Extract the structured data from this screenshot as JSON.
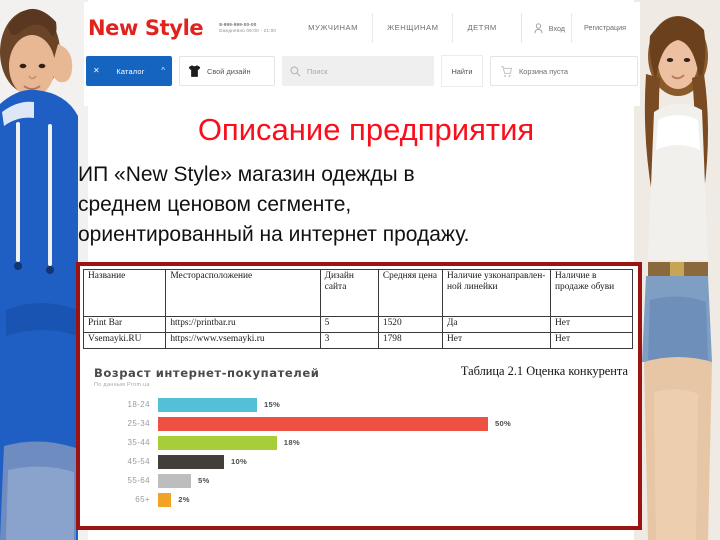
{
  "site": {
    "logo": "New Style",
    "phone": "8-999-999-00-00",
    "hours": "Ежедневно 09:00 - 21:00",
    "nav": [
      {
        "label": "МУЖЧИНАМ"
      },
      {
        "label": "ЖЕНЩИНАМ"
      },
      {
        "label": "ДЕТЯМ"
      }
    ],
    "login_label": "Вход",
    "register_label": "Регистрация",
    "catalog_label": "Каталог",
    "design_label": "Свой дизайн",
    "search_placeholder": "Поиск",
    "find_label": "Найти",
    "cart_label": "Корзина пуста",
    "icons": {
      "person": "person-icon",
      "tshirt": "tshirt-icon",
      "search": "search-icon",
      "cart": "cart-icon",
      "chevron": "chevron-up-icon",
      "close": "close-x-icon"
    },
    "accent_blue": "#1565c0",
    "logo_red": "#e0231d"
  },
  "slide": {
    "title": "Описание предприятия",
    "title_color": "#fc0d1b",
    "body_lines": [
      "ИП «New Style» магазин одежды в",
      "среднем ценовом сегменте,",
      "ориентированный на интернет продажу."
    ]
  },
  "table": {
    "caption": "Таблица 2.1 Оценка конкурента",
    "headers": [
      "Название",
      "Месторасположение",
      "Дизайн сайта",
      "Средняя цена",
      "Наличие узконаправлен-ной линейки",
      "Наличие в продаже обуви"
    ],
    "rows": [
      {
        "name": "Print Bar",
        "url": "https://printbar.ru",
        "design": "5",
        "price": "1520",
        "narrow_line": "Да",
        "shoes": "Нет"
      },
      {
        "name": "Vsemayki.RU",
        "url": "https://www.vsemayki.ru",
        "design": "3",
        "price": "1798",
        "narrow_line": "Нет",
        "shoes": "Нет"
      }
    ]
  },
  "chart_data": {
    "type": "bar",
    "orientation": "horizontal",
    "title": "Возраст интернет-покупателей",
    "subtitle": "По данным Prom.ua",
    "xlabel": "",
    "ylabel": "",
    "categories": [
      "18-24",
      "25-34",
      "35-44",
      "45-54",
      "55-64",
      "65+"
    ],
    "values": [
      15,
      50,
      18,
      10,
      5,
      2
    ],
    "labels": [
      "15%",
      "50%",
      "18%",
      "10%",
      "5%",
      "2%"
    ],
    "colors": [
      "#54c0d8",
      "#ef5044",
      "#a5ce39",
      "#423f3b",
      "#bdbdbd",
      "#f0a326"
    ],
    "xlim": [
      0,
      50
    ],
    "grid": false,
    "legend": "none"
  },
  "frame": {
    "border_color": "#9c1313"
  }
}
